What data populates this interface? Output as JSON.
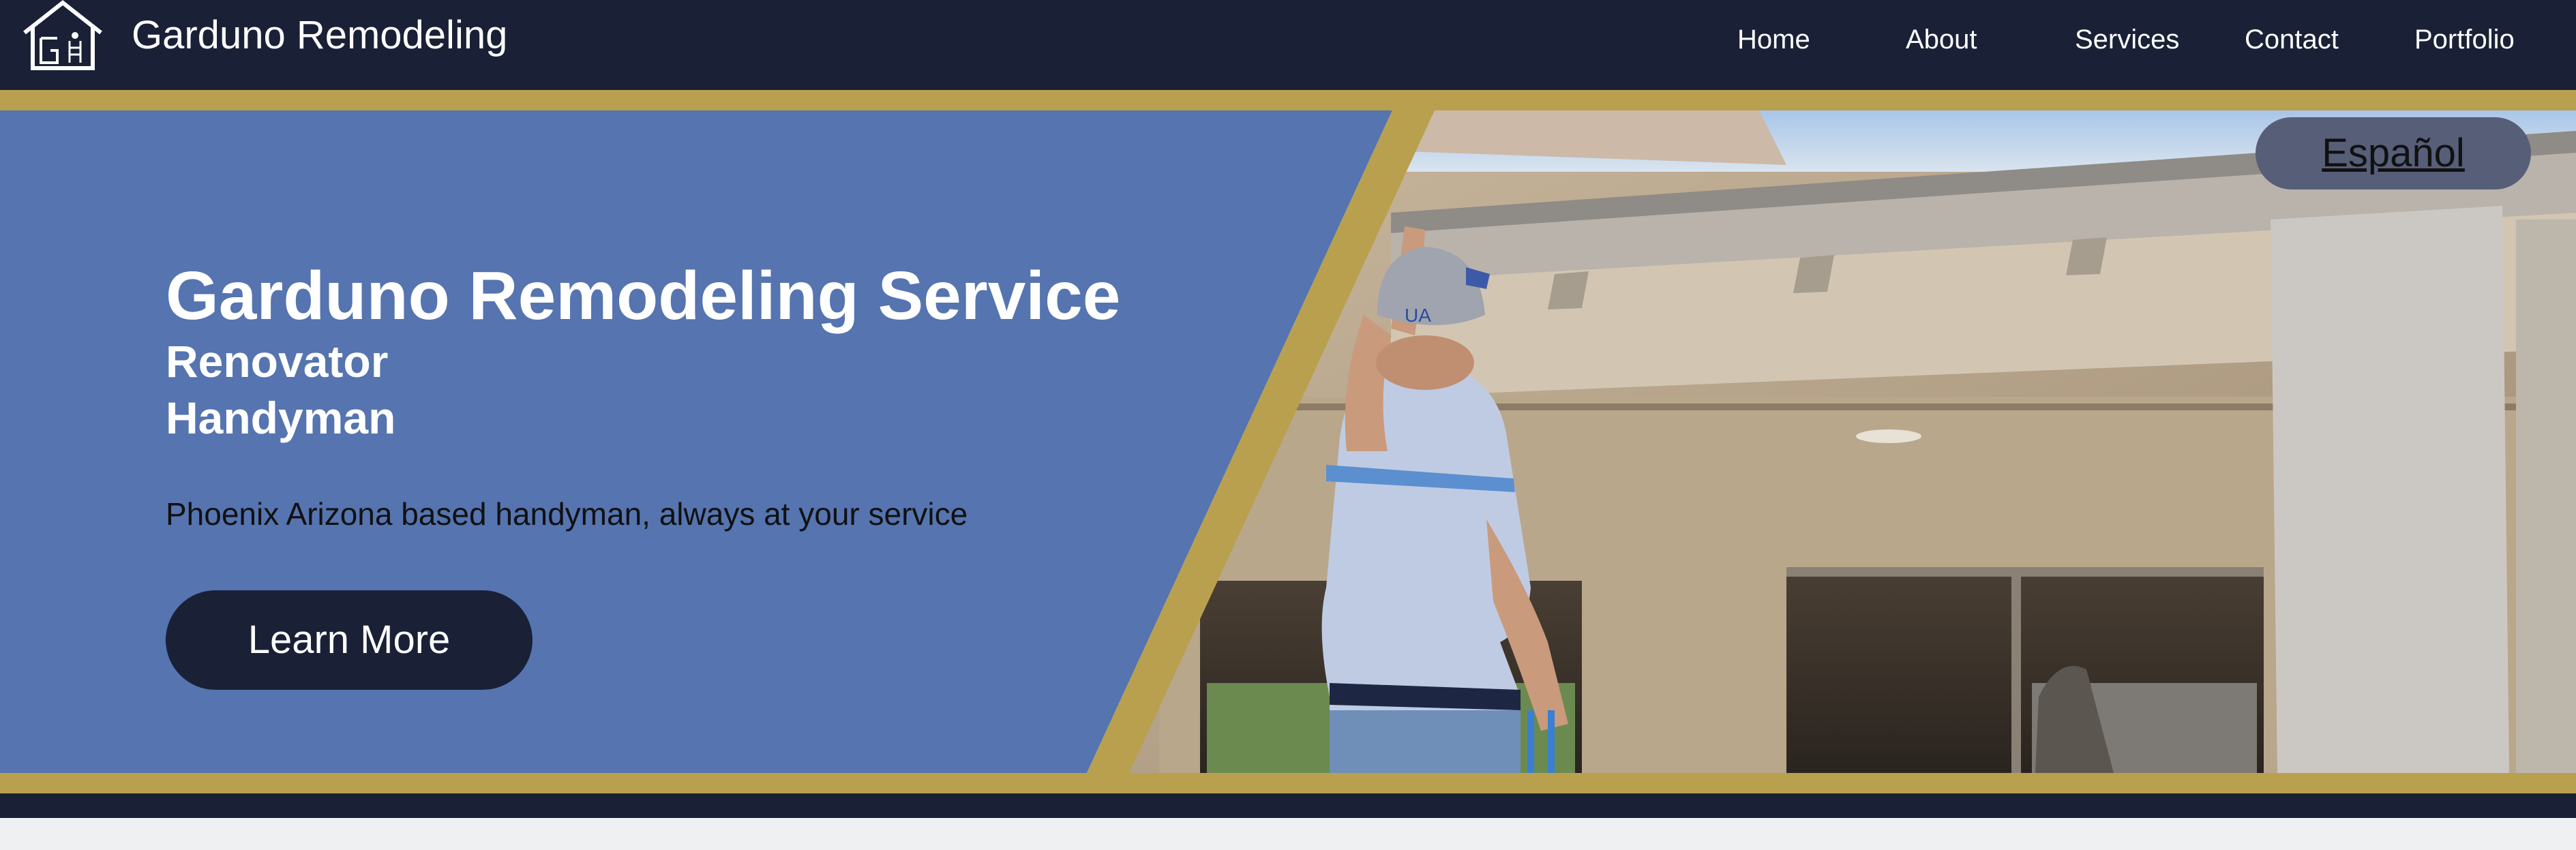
{
  "header": {
    "brand_name": "Garduno Remodeling",
    "nav": [
      {
        "label": "Home"
      },
      {
        "label": "About"
      },
      {
        "label": "Services"
      },
      {
        "label": "Contact"
      },
      {
        "label": "Portfolio"
      }
    ]
  },
  "hero": {
    "title": "Garduno Remodeling Service",
    "subtitle_1": "Renovator",
    "subtitle_2": "Handyman",
    "description": "Phoenix Arizona based handyman, always at your service",
    "cta_label": "Learn More",
    "language_toggle": "Español",
    "photo_subject": "Man in cap and striped polo working on the eave of a stucco house"
  },
  "colors": {
    "navy": "#1a2136",
    "gold": "#b8a04e",
    "hero_blue": "#5574b0",
    "language_pill": "#565e78",
    "page_bg": "#eef0f2"
  },
  "icons": {
    "logo": "house-with-tools-logo-icon"
  }
}
